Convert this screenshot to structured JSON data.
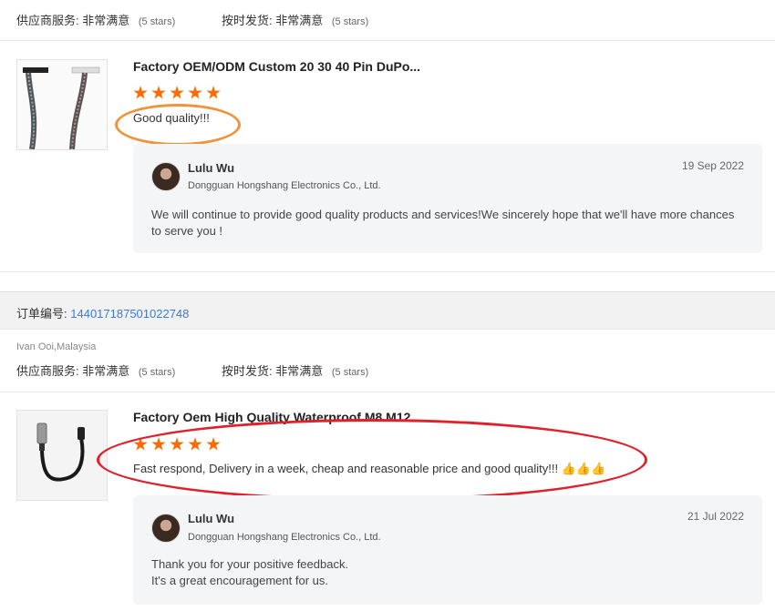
{
  "top_ratings": {
    "supplier_label": "供应商服务:",
    "supplier_value": "非常满意",
    "supplier_stars": "(5 stars)",
    "delivery_label": "按时发货:",
    "delivery_value": "非常满意",
    "delivery_stars": "(5 stars)"
  },
  "review1": {
    "product_title": "Factory OEM/ODM Custom 20 30 40 Pin DuPo...",
    "rating": 5,
    "text": "Good quality!!!",
    "reply": {
      "name": "Lulu Wu",
      "company": "Dongguan Hongshang Electronics Co., Ltd.",
      "date": "19 Sep 2022",
      "text": "We will continue to provide good quality products and services!We sincerely hope that we'll have more chances to serve you !"
    }
  },
  "order": {
    "label": "订单编号:",
    "number": "144017187501022748"
  },
  "buyer": "Ivan Ooi,Malaysia",
  "second_ratings": {
    "supplier_label": "供应商服务:",
    "supplier_value": "非常满意",
    "supplier_stars": "(5 stars)",
    "delivery_label": "按时发货:",
    "delivery_value": "非常满意",
    "delivery_stars": "(5 stars)"
  },
  "review2": {
    "product_title": "Factory Oem High Quality Waterproof M8 M12",
    "rating": 5,
    "text": "Fast respond, Delivery in a week, cheap and reasonable price and good quality!!!",
    "emojis": "👍👍👍",
    "reply": {
      "name": "Lulu Wu",
      "company": "Dongguan Hongshang Electronics Co., Ltd.",
      "date": "21 Jul 2022",
      "text_line1": "Thank you for your positive feedback.",
      "text_line2": "It's a great encouragement for us."
    }
  },
  "colors": {
    "star": "#ff6a00",
    "orange_highlight": "#f0943a",
    "red_highlight": "#e0202a",
    "link": "#3a7bd5"
  }
}
